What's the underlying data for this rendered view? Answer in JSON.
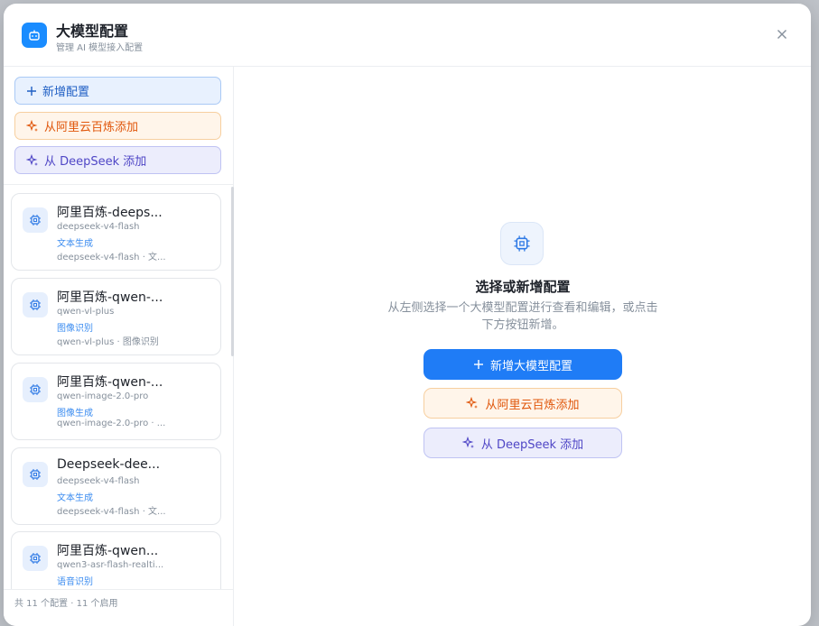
{
  "header": {
    "title": "大模型配置",
    "subtitle": "管理 AI 模型接入配置"
  },
  "sidebar": {
    "buttons": {
      "add": "新增配置",
      "aliyun": "从阿里云百炼添加",
      "deepseek": "从 DeepSeek 添加"
    },
    "items": [
      {
        "title": "阿里百炼-deeps...",
        "model": "deepseek-v4-flash",
        "tag": "文本生成",
        "desc": "deepseek-v4-flash · 文..."
      },
      {
        "title": "阿里百炼-qwen-...",
        "model": "qwen-vl-plus",
        "tag": "图像识别",
        "desc": "qwen-vl-plus · 图像识别"
      },
      {
        "title": "阿里百炼-qwen-...",
        "model": "qwen-image-2.0-pro",
        "tag": "图像生成",
        "desc": "qwen-image-2.0-pro · ..."
      },
      {
        "title": "Deepseek-dee...",
        "model": "deepseek-v4-flash",
        "tag": "文本生成",
        "desc": "deepseek-v4-flash · 文..."
      },
      {
        "title": "阿里百炼-qwen...",
        "model": "qwen3-asr-flash-realti...",
        "tag": "语音识别",
        "desc": ""
      }
    ],
    "footer": "共 11 个配置 · 11 个启用"
  },
  "main": {
    "empty_title": "选择或新增配置",
    "empty_desc": "从左侧选择一个大模型配置进行查看和编辑，或点击下方按钮新增。",
    "buttons": {
      "add": "新增大模型配置",
      "aliyun": "从阿里云百炼添加",
      "deepseek": "从 DeepSeek 添加"
    }
  },
  "colors": {
    "accent": "#1f7cf6",
    "aliyun_orange": "#e0560b",
    "deepseek_purple": "#4f46c6",
    "tag_blue": "#3b8cf0"
  },
  "icons": {
    "header": "robot-icon",
    "close": "close-icon",
    "add": "plus-icon",
    "sparkle": "sparkle-icon",
    "chip": "chip-icon"
  }
}
